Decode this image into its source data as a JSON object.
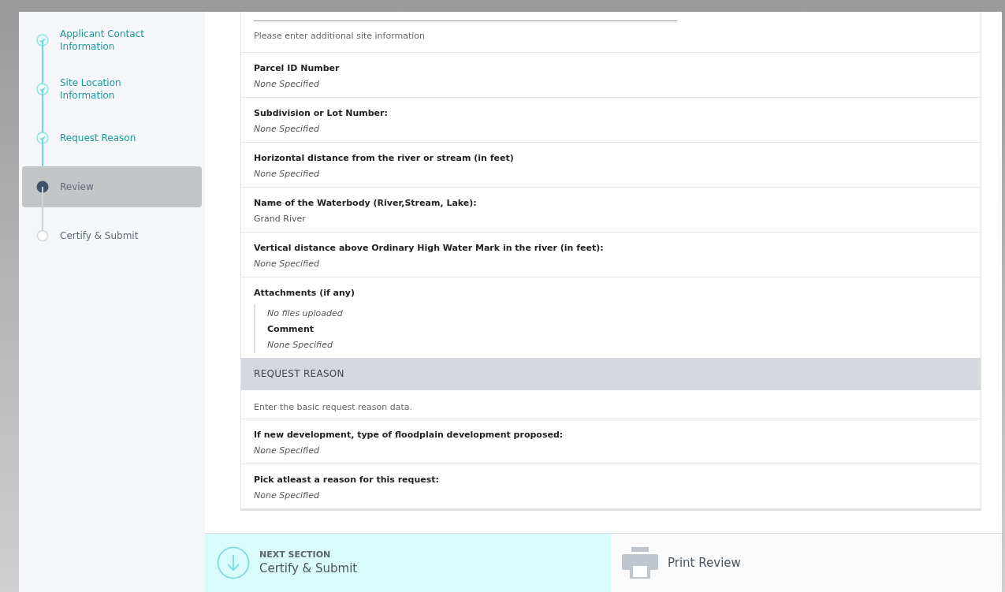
{
  "steps": [
    {
      "label": "Applicant Contact Information",
      "kind": "complete",
      "selected": false
    },
    {
      "label": "Site Location Information",
      "kind": "complete",
      "selected": false
    },
    {
      "label": "Request Reason",
      "kind": "complete",
      "selected": false
    },
    {
      "label": "Review",
      "kind": "current",
      "selected": true
    },
    {
      "label": "Certify & Submit",
      "kind": "pending",
      "selected": false
    }
  ],
  "site_section": {
    "description": "Please enter additional site information",
    "fields": [
      {
        "kind": "field",
        "label": "Parcel ID Number",
        "value": "None Specified",
        "empty": true
      },
      {
        "kind": "field",
        "label": "Subdivision or Lot Number:",
        "value": "None Specified",
        "empty": true
      },
      {
        "kind": "field",
        "label": "Horizontal distance from the river or stream (in feet)",
        "value": "None Specified",
        "empty": true
      },
      {
        "kind": "field",
        "label": "Name of the Waterbody (River,Stream, Lake):",
        "value": "Grand River",
        "empty": false
      },
      {
        "kind": "field",
        "label": "Vertical distance above Ordinary High Water Mark in the river (in feet):",
        "value": "None Specified",
        "empty": true
      },
      {
        "kind": "attachments",
        "label": "Attachments (if any)",
        "files": "No files uploaded",
        "comment_label": "Comment",
        "comment": "None Specified"
      }
    ]
  },
  "request_reason": {
    "title": "REQUEST REASON",
    "description": "Enter the basic request reason data.",
    "fields": [
      {
        "kind": "field",
        "label": "If new development, type of floodplain development proposed:",
        "value": "None Specified",
        "empty": true
      },
      {
        "kind": "field",
        "label": "Pick atleast a reason for this request:",
        "value": "None Specified",
        "empty": true
      }
    ]
  },
  "footer": {
    "next_caption": "NEXT SECTION",
    "next_label": "Certify & Submit",
    "print_label": "Print Review"
  }
}
